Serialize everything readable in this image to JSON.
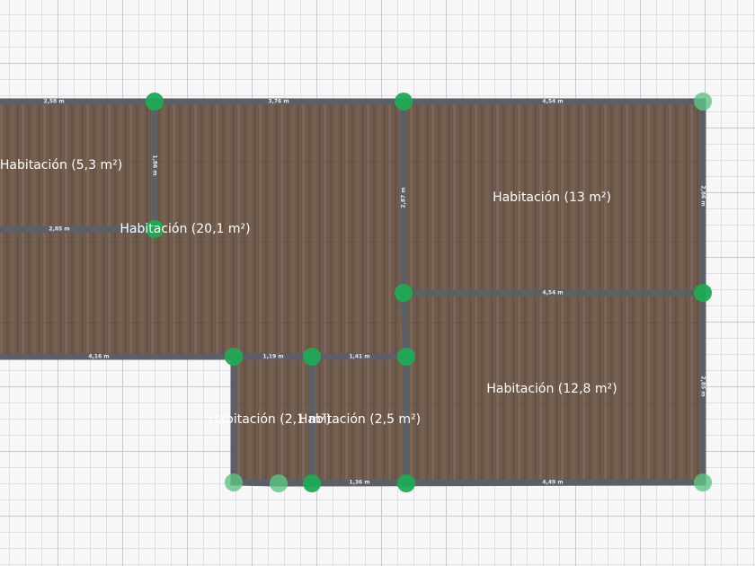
{
  "app": {
    "unit": "m"
  },
  "colors": {
    "wall": "#5b6068",
    "node": "#1faa55",
    "node_faded": "#5cc482",
    "floor": "#6f5b4d",
    "grid": "#c9c9cf"
  },
  "rooms": [
    {
      "label": "Habitación (5,3 m²)"
    },
    {
      "label": "Habitación (20,1 m²)"
    },
    {
      "label": "Habitación (13 m²)"
    },
    {
      "label": "Habitación (12,8 m²)"
    },
    {
      "label": "Habitación (2,1 m²)"
    },
    {
      "label": "Habitación (2,5 m²)"
    }
  ],
  "dimensions": [
    {
      "label": "2,58 m"
    },
    {
      "label": "3,76 m"
    },
    {
      "label": "4,54 m"
    },
    {
      "label": "1,86 m"
    },
    {
      "label": "2,85 m"
    },
    {
      "label": "2,87 m"
    },
    {
      "label": "2,86 m"
    },
    {
      "label": "4,54 m"
    },
    {
      "label": "4,16 m"
    },
    {
      "label": "1,19 m"
    },
    {
      "label": "1,41 m"
    },
    {
      "label": "2,85 m"
    },
    {
      "label": "1,36 m"
    },
    {
      "label": "4,49 m"
    }
  ]
}
